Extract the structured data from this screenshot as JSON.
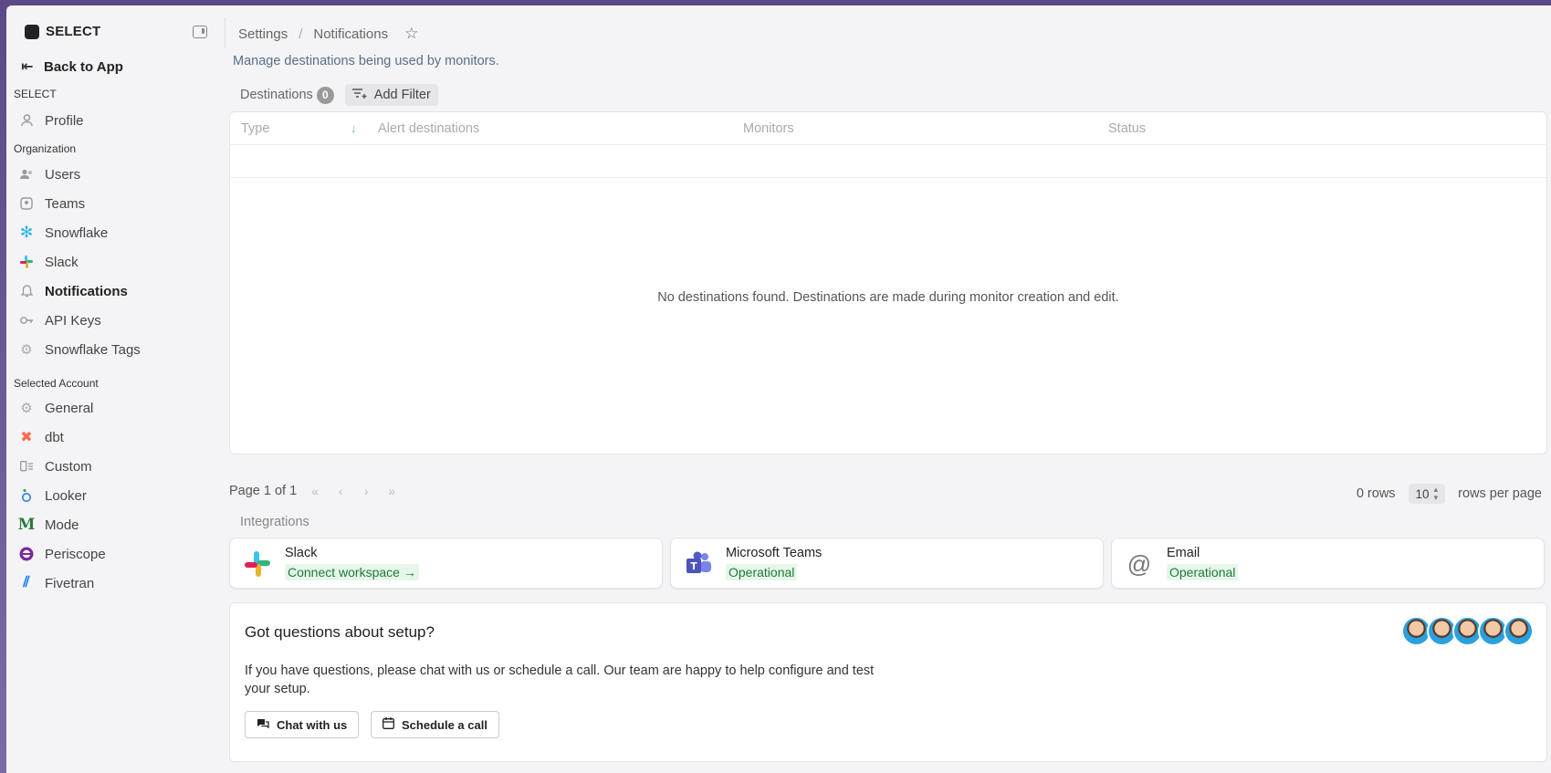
{
  "sidebar": {
    "brand": "SELECT",
    "back_label": "Back to App",
    "section_select": "SELECT",
    "section_org": "Organization",
    "section_account": "Selected Account",
    "items": [
      {
        "label": "Profile",
        "icon": "user-icon"
      },
      {
        "label": "Users",
        "icon": "users-icon"
      },
      {
        "label": "Teams",
        "icon": "teams-icon"
      },
      {
        "label": "Snowflake",
        "icon": "snowflake-icon"
      },
      {
        "label": "Slack",
        "icon": "slack-icon"
      },
      {
        "label": "Notifications",
        "icon": "bell-icon"
      },
      {
        "label": "API Keys",
        "icon": "key-icon"
      },
      {
        "label": "Snowflake Tags",
        "icon": "tag-gear-icon"
      },
      {
        "label": "General",
        "icon": "gear-icon"
      },
      {
        "label": "dbt",
        "icon": "dbt-icon"
      },
      {
        "label": "Custom",
        "icon": "custom-icon"
      },
      {
        "label": "Looker",
        "icon": "looker-icon"
      },
      {
        "label": "Mode",
        "icon": "mode-icon"
      },
      {
        "label": "Periscope",
        "icon": "periscope-icon"
      },
      {
        "label": "Fivetran",
        "icon": "fivetran-icon"
      }
    ]
  },
  "header": {
    "crumb_settings": "Settings",
    "crumb_sep": "/",
    "crumb_current": "Notifications",
    "subtitle": "Manage destinations being used by monitors."
  },
  "tabs": {
    "destinations_label": "Destinations",
    "destinations_count": "0",
    "add_filter_label": "Add Filter"
  },
  "table": {
    "columns": [
      "Type",
      "Alert destinations",
      "Monitors",
      "Status"
    ],
    "empty_message": "No destinations found. Destinations are made during monitor creation and edit."
  },
  "pagination": {
    "page_text": "Page 1 of 1",
    "rows_text": "0 rows",
    "rows_per_page_value": "10",
    "rows_per_page_label": "rows per page"
  },
  "integrations": {
    "label": "Integrations",
    "cards": [
      {
        "name": "Slack",
        "status": "Connect workspace →",
        "icon": "slack-icon"
      },
      {
        "name": "Microsoft Teams",
        "status": "Operational",
        "icon": "teams-icon"
      },
      {
        "name": "Email",
        "status": "Operational",
        "icon": "at-icon"
      }
    ]
  },
  "help": {
    "title": "Got questions about setup?",
    "body": "If you have questions, please chat with us or schedule a call. Our team are happy to help configure and test your setup.",
    "chat_label": "Chat with us",
    "schedule_label": "Schedule a call"
  },
  "colors": {
    "accent_green": "#1e7a3a",
    "status_bg": "#e6f7e9",
    "subtitle": "#5a6e8a"
  }
}
